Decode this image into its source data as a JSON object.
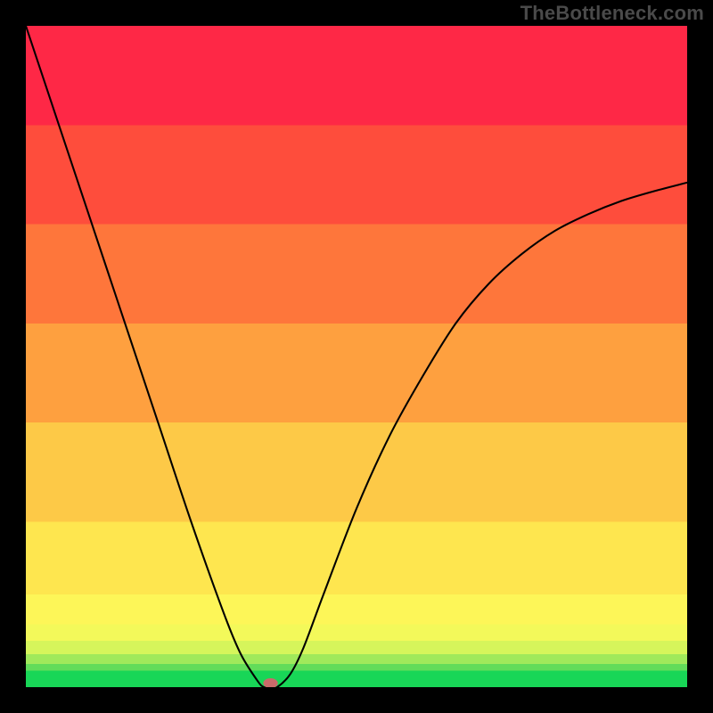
{
  "watermark": "TheBottleneck.com",
  "chart_data": {
    "type": "line",
    "title": "",
    "xlabel": "",
    "ylabel": "",
    "xlim": [
      0,
      100
    ],
    "ylim": [
      0,
      100
    ],
    "x": [
      0,
      5,
      10,
      15,
      20,
      25,
      30,
      32.5,
      35,
      36,
      37,
      38,
      40,
      42,
      45,
      50,
      55,
      60,
      65,
      70,
      75,
      80,
      85,
      90,
      95,
      100
    ],
    "values": [
      100,
      85,
      70,
      55,
      40,
      25,
      11,
      5,
      1,
      0,
      0,
      0,
      2,
      6,
      14,
      27,
      38,
      47,
      55,
      61,
      65.5,
      69,
      71.5,
      73.5,
      75,
      76.3
    ],
    "flat_segment": {
      "x_start": 35,
      "x_end": 38,
      "y": 0
    },
    "marker": {
      "x": 37,
      "y": 0,
      "color": "#c96a6a"
    },
    "background_bands": [
      {
        "y0": 0.0,
        "y1": 2.5,
        "color": "#18d657"
      },
      {
        "y0": 2.5,
        "y1": 3.5,
        "color": "#62dc5a"
      },
      {
        "y0": 3.5,
        "y1": 5.0,
        "color": "#a0e95b"
      },
      {
        "y0": 5.0,
        "y1": 7.0,
        "color": "#d6f55b"
      },
      {
        "y0": 7.0,
        "y1": 9.5,
        "color": "#f3f95a"
      },
      {
        "y0": 9.5,
        "y1": 14.0,
        "color": "#fdf658"
      },
      {
        "y0": 14.0,
        "y1": 25.0,
        "color": "#fee64f"
      },
      {
        "y0": 25.0,
        "y1": 40.0,
        "color": "#fdc947"
      },
      {
        "y0": 40.0,
        "y1": 55.0,
        "color": "#fea03f"
      },
      {
        "y0": 55.0,
        "y1": 70.0,
        "color": "#fe763b"
      },
      {
        "y0": 70.0,
        "y1": 85.0,
        "color": "#fe4d3c"
      },
      {
        "y0": 85.0,
        "y1": 100.0,
        "color": "#fe2846"
      }
    ]
  }
}
